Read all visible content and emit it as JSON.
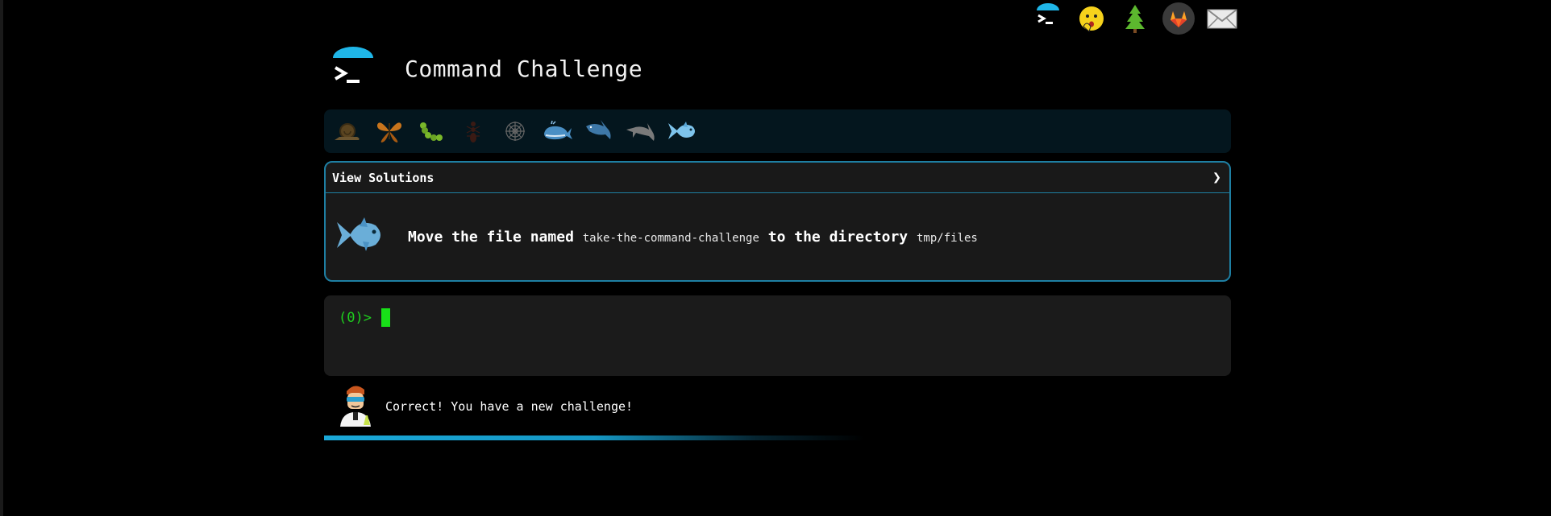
{
  "app": {
    "title": "Command Challenge"
  },
  "top_icons": [
    "terminal-logo-icon",
    "hushed-face-icon",
    "tree-icon",
    "gitlab-icon",
    "envelope-icon"
  ],
  "levels": [
    {
      "name": "snail-icon"
    },
    {
      "name": "butterfly-icon"
    },
    {
      "name": "caterpillar-icon"
    },
    {
      "name": "ant-icon"
    },
    {
      "name": "spider-web-icon"
    },
    {
      "name": "whale-icon"
    },
    {
      "name": "shark-icon"
    },
    {
      "name": "dolphin-icon"
    },
    {
      "name": "fish-icon",
      "active": true
    }
  ],
  "card": {
    "header": "View Solutions",
    "toggle": "❯",
    "challenge_prefix": "Move the file named",
    "file_name": "take-the-command-challenge",
    "challenge_middle": "to the directory",
    "directory": "tmp/files"
  },
  "terminal": {
    "prompt": "(0)>"
  },
  "status": {
    "message": "Correct! You have a new challenge!"
  },
  "colors": {
    "accent": "#1fb6e8",
    "terminal_green": "#1ecf1e",
    "card_border": "#1e7fa3"
  }
}
